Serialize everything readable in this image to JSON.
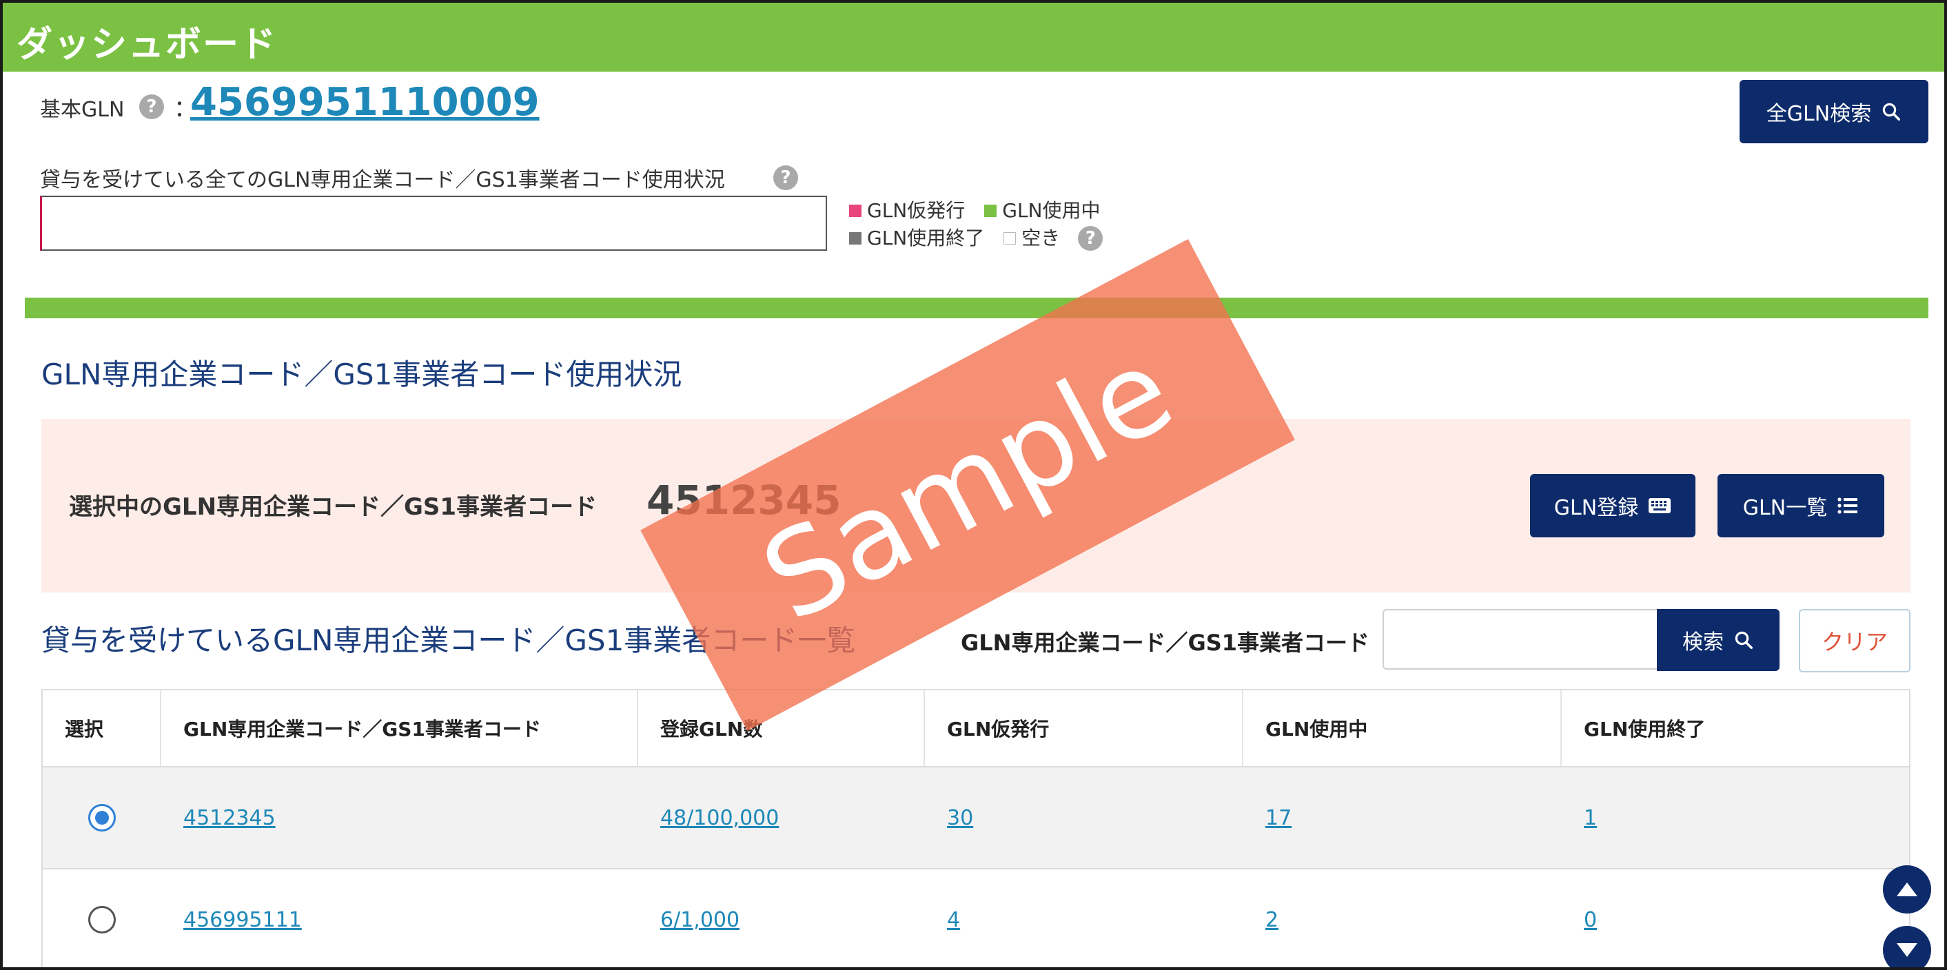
{
  "header": {
    "title": "ダッシュボード"
  },
  "base_gln": {
    "label": "基本GLN",
    "colon": "：",
    "value": "4569951110009",
    "help_glyph": "?"
  },
  "buttons": {
    "all_gln_search": "全GLN検索",
    "gln_register": "GLN登録",
    "gln_list": "GLN一覧",
    "search": "検索",
    "clear": "クリア"
  },
  "usage": {
    "label": "貸与を受けている全てのGLN専用企業コード／GS1事業者コード使用状況"
  },
  "legend": [
    {
      "label": "GLN仮発行",
      "color": "#e8457c"
    },
    {
      "label": "GLN使用中",
      "color": "#7bc143"
    },
    {
      "label": "GLN使用終了",
      "color": "#777777"
    },
    {
      "label": "空き",
      "color": "#ffffff"
    }
  ],
  "section": {
    "title": "GLN専用企業コード／GS1事業者コード使用状況"
  },
  "selected": {
    "label": "選択中のGLN専用企業コード／GS1事業者コード",
    "code": "4512345"
  },
  "list": {
    "title": "貸与を受けているGLN専用企業コード／GS1事業者コード一覧",
    "filter_label": "GLN専用企業コード／GS1事業者コード",
    "filter_value": ""
  },
  "table": {
    "headers": [
      "選択",
      "GLN専用企業コード／GS1事業者コード",
      "登録GLN数",
      "GLN仮発行",
      "GLN使用中",
      "GLN使用終了"
    ],
    "rows": [
      {
        "selected": true,
        "code": "4512345",
        "registered": "48/100,000",
        "provisional": "30",
        "in_use": "17",
        "ended": "1"
      },
      {
        "selected": false,
        "code": "456995111",
        "registered": "6/1,000",
        "provisional": "4",
        "in_use": "2",
        "ended": "0"
      }
    ]
  },
  "watermark": {
    "text": "Sample"
  },
  "colors": {
    "brand_green": "#7bc143",
    "navy": "#0d2b6b",
    "link": "#1e88b8",
    "panel_pink": "#fdece8",
    "stamp": "#f3714e"
  },
  "icons": {
    "search": "search-icon",
    "keyboard": "keyboard-icon",
    "list": "list-icon",
    "scroll_up": "arrow-up-icon",
    "scroll_down": "arrow-down-icon",
    "help": "help-icon"
  }
}
